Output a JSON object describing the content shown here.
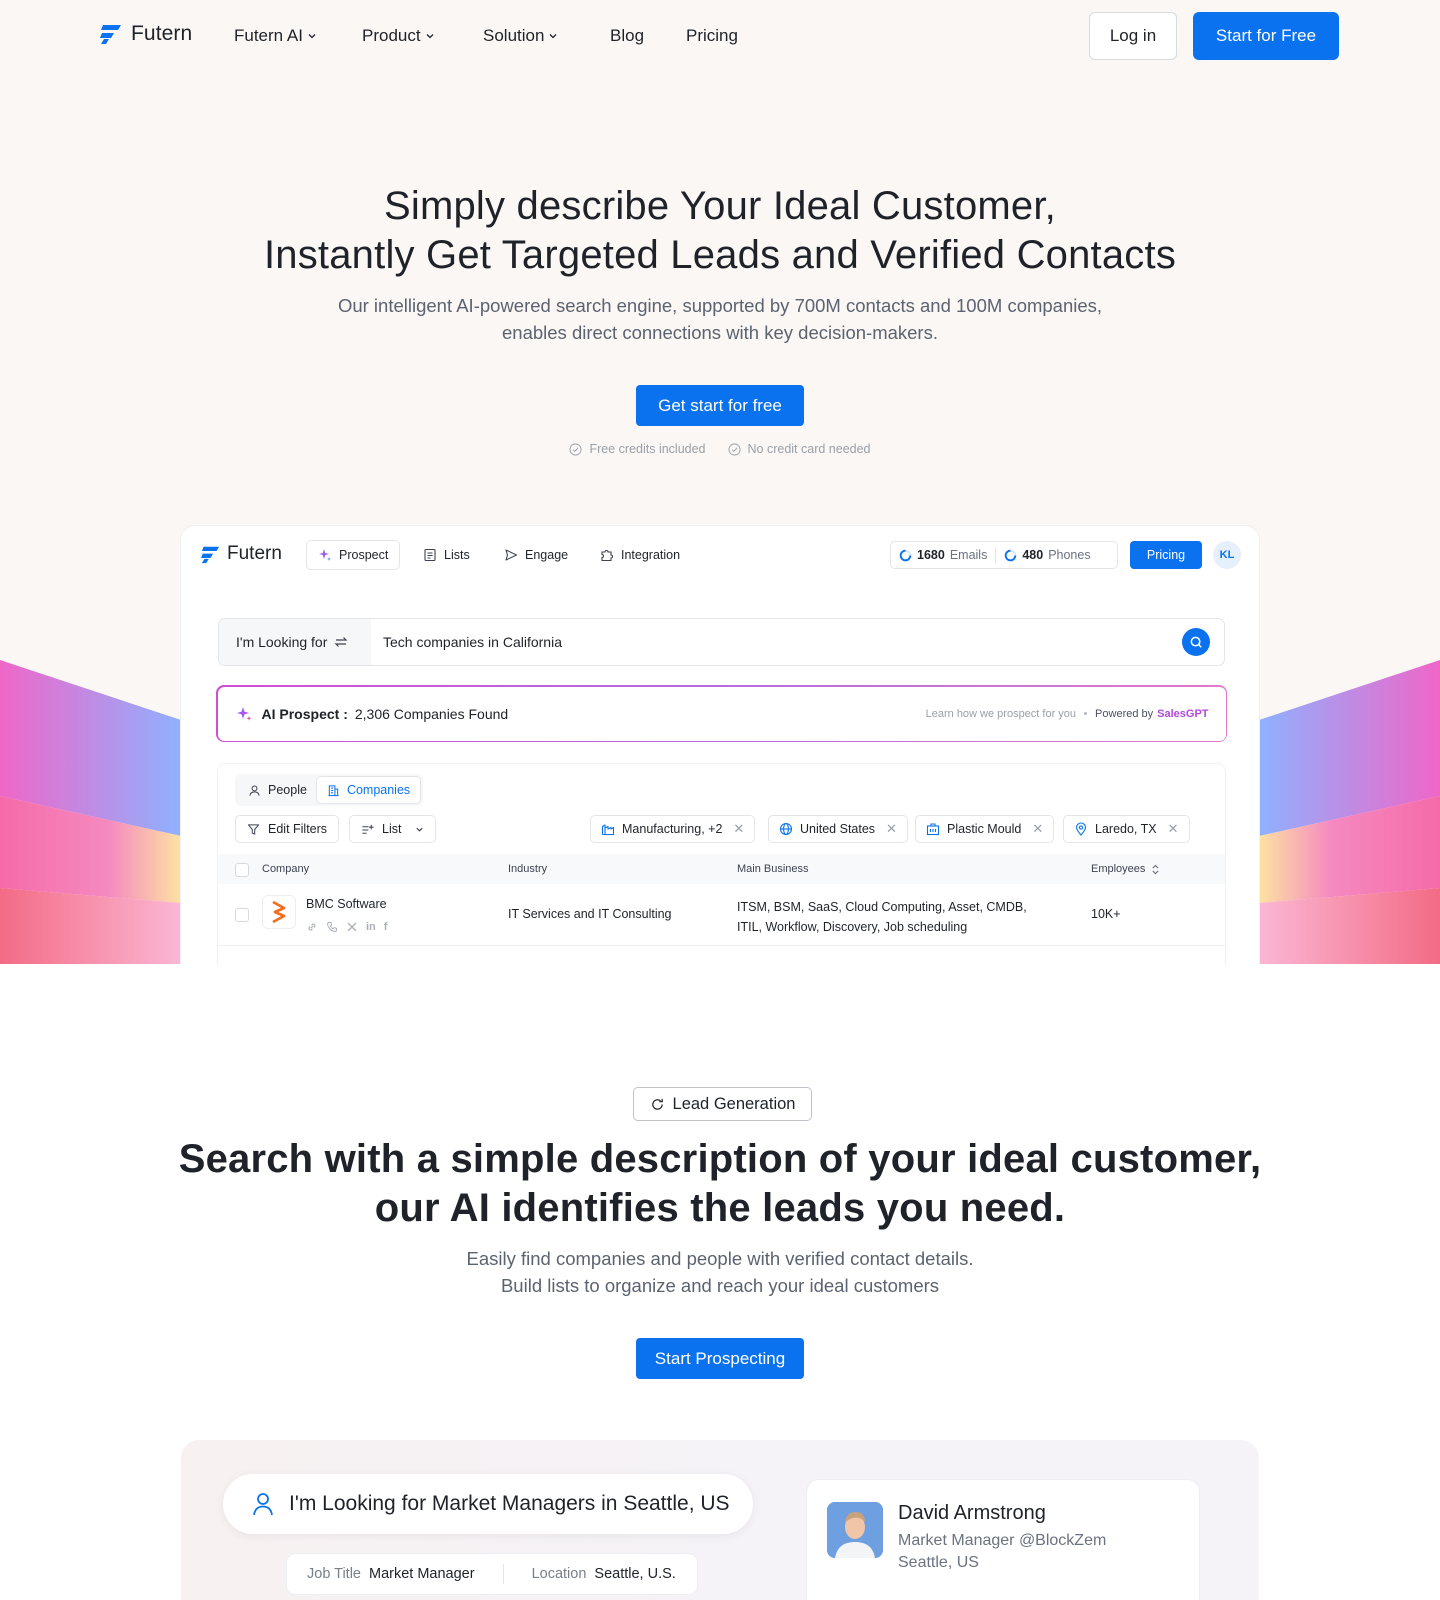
{
  "colors": {
    "brand": "#0a72ef",
    "accent_gradient": "#d04ed6",
    "text": "#1f2329",
    "muted": "#5c6370"
  },
  "nav": {
    "brand": "Futern",
    "items": [
      {
        "label": "Futern AI",
        "has_dropdown": true
      },
      {
        "label": "Product",
        "has_dropdown": true
      },
      {
        "label": "Solution",
        "has_dropdown": true
      },
      {
        "label": "Blog",
        "has_dropdown": false
      },
      {
        "label": "Pricing",
        "has_dropdown": false
      }
    ],
    "login": "Log in",
    "start": "Start for Free"
  },
  "hero": {
    "title_line1": "Simply describe Your Ideal Customer,",
    "title_line2": "Instantly Get Targeted Leads and Verified Contacts",
    "sub_line1": "Our intelligent AI-powered search engine, supported by 700M contacts and 100M companies,",
    "sub_line2": "enables direct connections with key decision-makers.",
    "cta": "Get start for free",
    "badges": [
      "Free credits included",
      "No credit card needed"
    ]
  },
  "app": {
    "brand": "Futern",
    "tabs": [
      {
        "label": "Prospect",
        "icon": "sparkle-icon"
      },
      {
        "label": "Lists",
        "icon": "list-icon"
      },
      {
        "label": "Engage",
        "icon": "send-icon"
      },
      {
        "label": "Integration",
        "icon": "puzzle-icon"
      }
    ],
    "credits": [
      {
        "value": "1680",
        "unit": "Emails"
      },
      {
        "value": "480",
        "unit": "Phones"
      }
    ],
    "pricing": "Pricing",
    "avatar": "KL",
    "search": {
      "mode": "I'm Looking for",
      "query": "Tech companies in California"
    },
    "ai": {
      "label": "AI Prospect :",
      "count": "2,306 Companies Found",
      "learn": "Learn how we prospect for you",
      "powered": "Powered by",
      "powered_brand": "SalesGPT"
    },
    "segments": [
      "People",
      "Companies"
    ],
    "buttons": {
      "edit_filters": "Edit Filters",
      "list": "List"
    },
    "chips": [
      {
        "label": "Manufacturing, +2",
        "icon": "factory-icon"
      },
      {
        "label": "United States",
        "icon": "globe-icon"
      },
      {
        "label": "Plastic Mould",
        "icon": "building-icon"
      },
      {
        "label": "Laredo, TX",
        "icon": "location-icon"
      }
    ],
    "table": {
      "headers": [
        "Company",
        "Industry",
        "Main Business",
        "Employees"
      ],
      "rows": [
        {
          "company": "BMC Software",
          "industry": "IT Services and IT Consulting",
          "business_line1": "ITSM, BSM, SaaS, Cloud Computing, Asset, CMDB,",
          "business_line2": "ITIL, Workflow, Discovery, Job scheduling",
          "employees": "10K+"
        }
      ]
    }
  },
  "section2": {
    "pill": "Lead Generation",
    "title_line1": "Search with a simple description of your ideal customer,",
    "title_line2": "our AI identifies the leads you need.",
    "sub_line1": "Easily find companies and people with verified contact details.",
    "sub_line2": "Build lists to organize and reach your ideal customers",
    "cta": "Start Prospecting"
  },
  "preview": {
    "query": "I'm Looking for Market Managers in Seattle, US",
    "criteria": [
      {
        "key": "Job Title",
        "value": "Market Manager"
      },
      {
        "key": "Location",
        "value": "Seattle, U.S."
      }
    ],
    "person": {
      "name": "David Armstrong",
      "role": "Market Manager @BlockZem",
      "location": "Seattle, US"
    }
  }
}
